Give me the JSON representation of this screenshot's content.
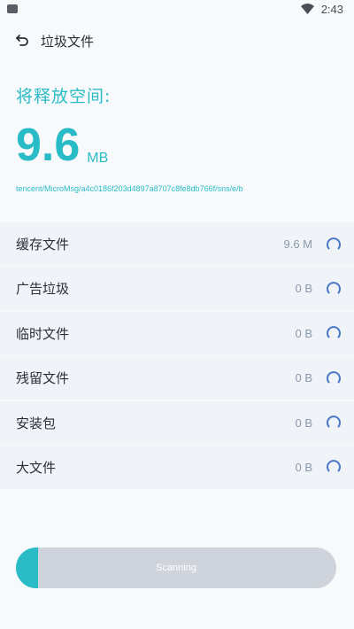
{
  "status_bar": {
    "time": "2:43",
    "left_icon": "notification-square-icon",
    "right_icon": "wifi-icon"
  },
  "app_bar": {
    "back_icon": "back-arrow-icon",
    "title": "垃圾文件"
  },
  "summary": {
    "label": "将释放空间:",
    "value": "9.6",
    "unit": "MB",
    "path": "tencent/MicroMsg/a4c0186f203d4897a8707c8fe8db766f/sns/e/b"
  },
  "categories": [
    {
      "label": "缓存文件",
      "size": "9.6 M",
      "icon": "loading-spinner-icon"
    },
    {
      "label": "广告垃圾",
      "size": "0 B",
      "icon": "loading-spinner-icon"
    },
    {
      "label": "临时文件",
      "size": "0 B",
      "icon": "loading-spinner-icon"
    },
    {
      "label": "残留文件",
      "size": "0 B",
      "icon": "loading-spinner-icon"
    },
    {
      "label": "安装包",
      "size": "0 B",
      "icon": "loading-spinner-icon"
    },
    {
      "label": "大文件",
      "size": "0 B",
      "icon": "loading-spinner-icon"
    }
  ],
  "progress": {
    "label": "Scanning",
    "fraction": 0.07
  },
  "colors": {
    "accent": "#2abcc6",
    "row_bg": "#f0f4f9",
    "spinner": "#4a78c6",
    "track": "#cfd3db"
  }
}
